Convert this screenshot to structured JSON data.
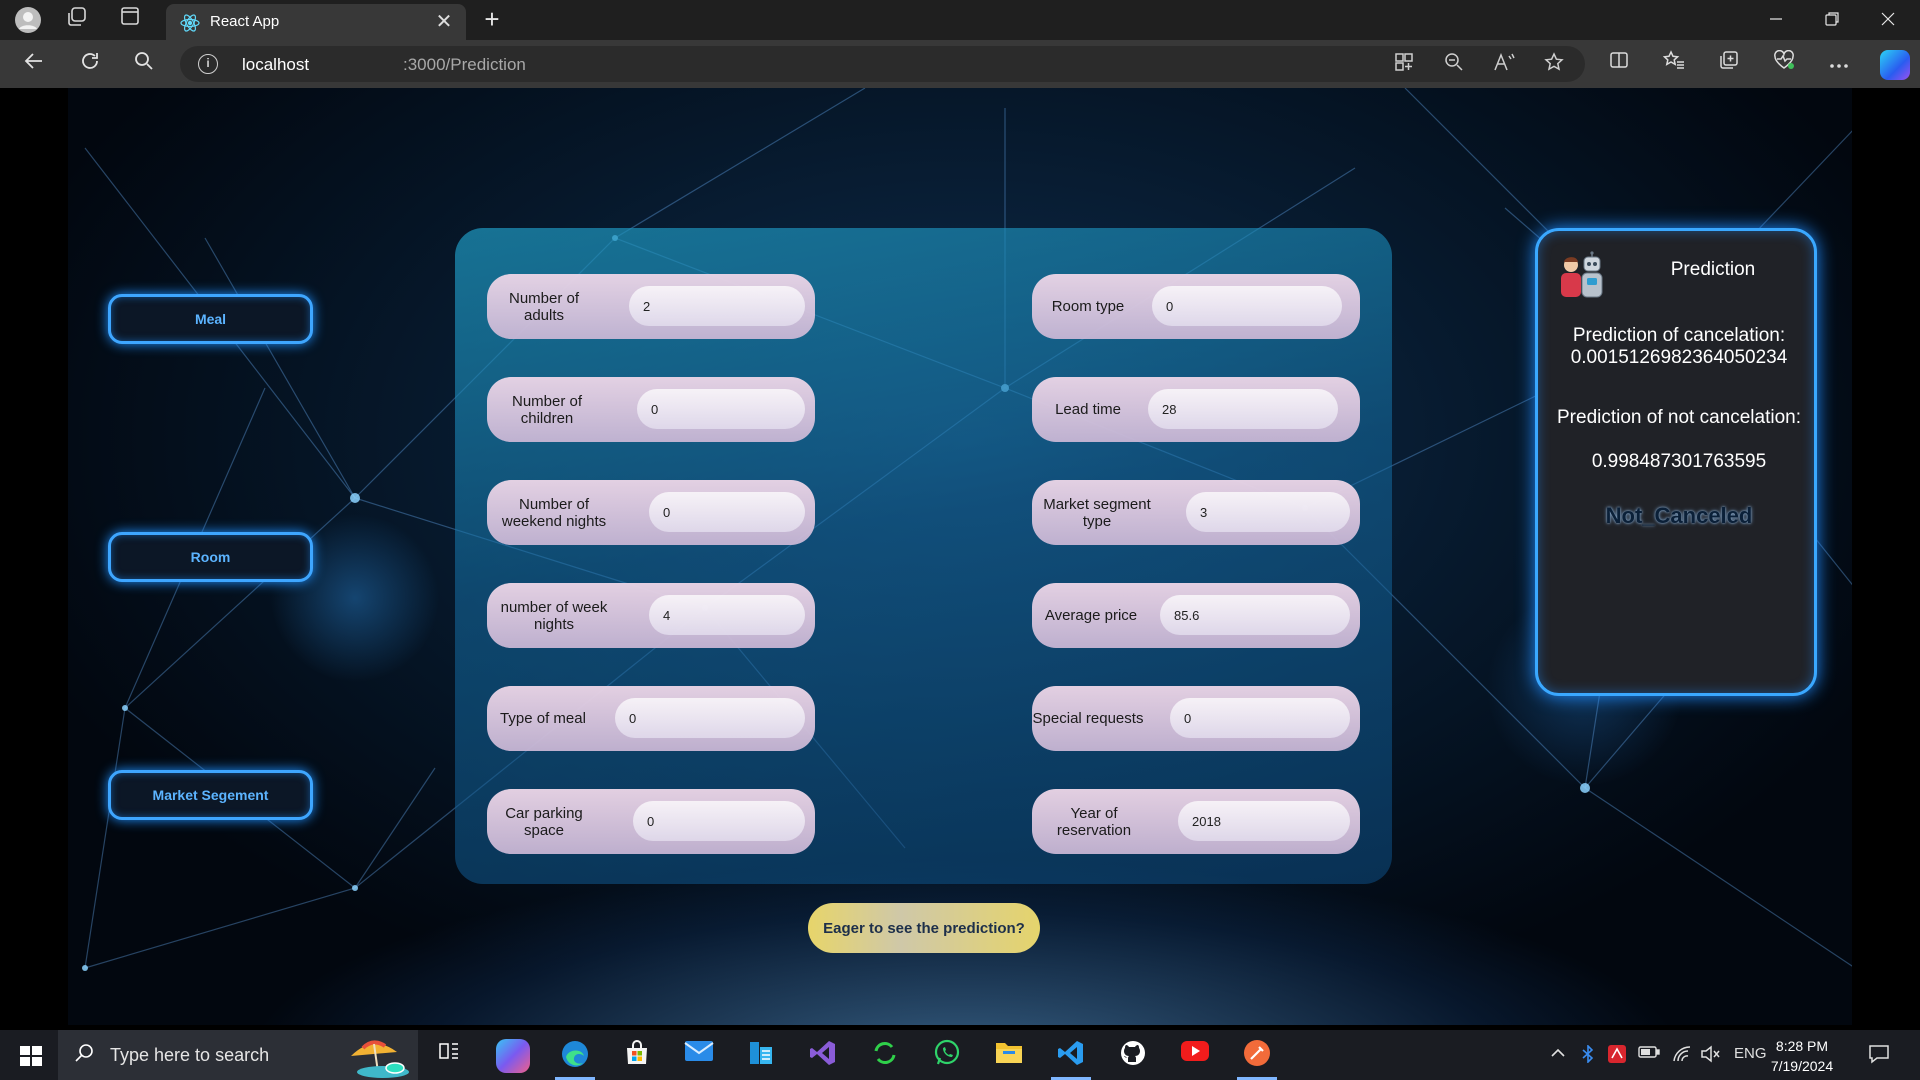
{
  "browser": {
    "tab_title": "React App",
    "new_tab": "+",
    "close_tab": "✕",
    "url_host": "localhost",
    "url_path": ":3000/Prediction"
  },
  "sidebar": {
    "meal_label": "Meal",
    "room_label": "Room",
    "market_label": "Market Segement"
  },
  "form": {
    "fields": [
      {
        "label": "Number of adults",
        "value": "2"
      },
      {
        "label": "Number of children",
        "value": "0"
      },
      {
        "label": "Number of weekend nights",
        "value": "0"
      },
      {
        "label": "number of week nights",
        "value": "4"
      },
      {
        "label": "Type of meal",
        "value": "0"
      },
      {
        "label": "Car parking space",
        "value": "0"
      },
      {
        "label": "Room type",
        "value": "0"
      },
      {
        "label": "Lead time",
        "value": "28"
      },
      {
        "label": "Market segment type",
        "value": "3"
      },
      {
        "label": "Average price",
        "value": "85.6"
      },
      {
        "label": "Special requests",
        "value": "0"
      },
      {
        "label": "Year of reservation",
        "value": "2018"
      }
    ],
    "submit_label": "Eager to see the prediction?"
  },
  "prediction": {
    "title": "Prediction",
    "cancel_label": "Prediction of cancelation:",
    "cancel_value": "0.0015126982364050234",
    "not_cancel_label": "Prediction of not cancelation:",
    "not_cancel_value": "0.998487301763595",
    "status": "Not_Canceled"
  },
  "taskbar": {
    "search_placeholder": "Type here to search",
    "language": "ENG",
    "time": "8:28 PM",
    "date": "7/19/2024"
  },
  "colors": {
    "accent_blue": "#3ea6ff",
    "panel_teal": "#1e96be",
    "submit_yellow": "#e7d56a"
  }
}
